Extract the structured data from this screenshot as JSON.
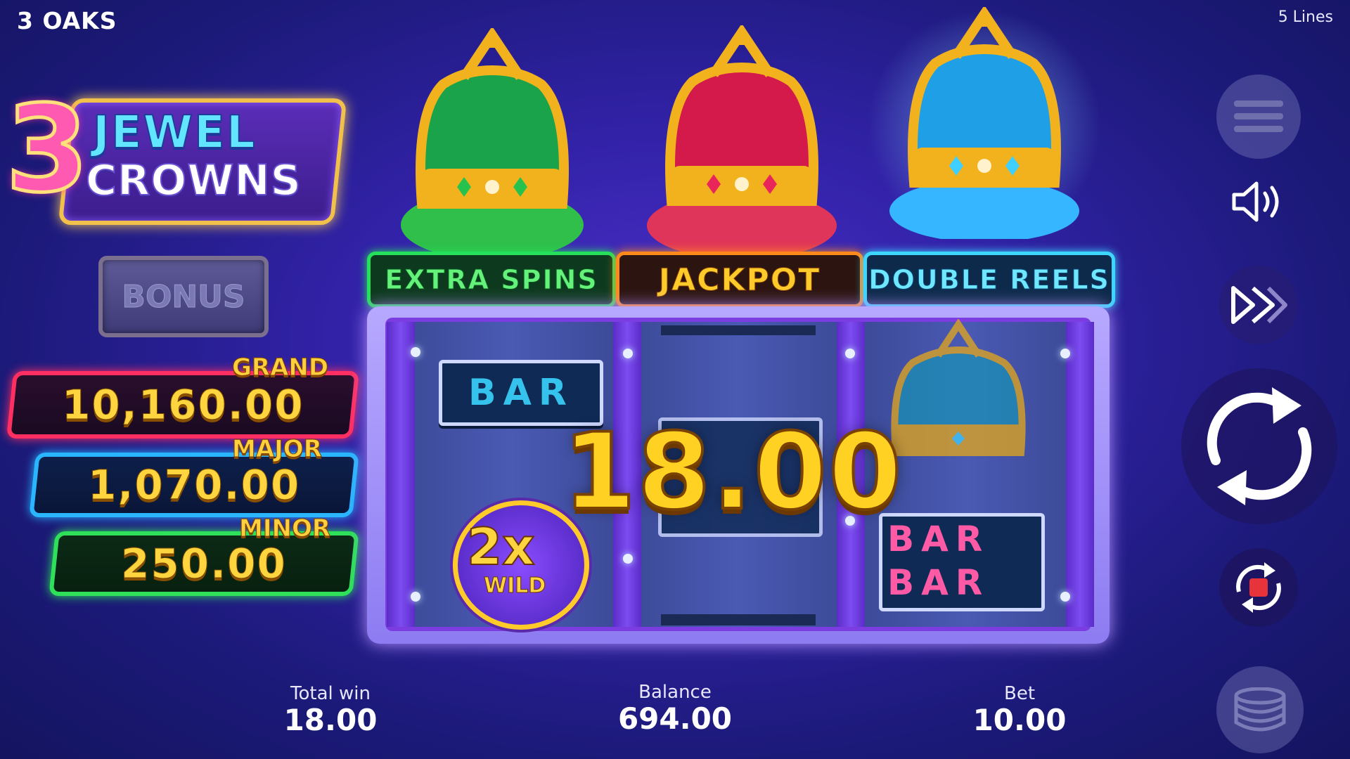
{
  "header": {
    "brand": "3 OAKS",
    "lines": "5 Lines"
  },
  "logo": {
    "digit": "3",
    "line1": "JEWEL",
    "line2": "CROWNS"
  },
  "bonus_button": "BONUS",
  "jackpots": {
    "grand": {
      "label": "GRAND",
      "value": "10,160.00"
    },
    "major": {
      "label": "MAJOR",
      "value": "1,070.00"
    },
    "minor": {
      "label": "MINOR",
      "value": "250.00"
    }
  },
  "features": {
    "extra_spins": "EXTRA SPINS",
    "jackpot": "JACKPOT",
    "double_reels": "DOUBLE REELS"
  },
  "reels": {
    "bar": "BAR",
    "wild_multiplier": "2x",
    "wild_label": "WILD"
  },
  "win_amount": "18.00",
  "footer": {
    "total_win_label": "Total win",
    "total_win_value": "18.00",
    "balance_label": "Balance",
    "balance_value": "694.00",
    "bet_label": "Bet",
    "bet_value": "10.00"
  },
  "colors": {
    "accent_gold": "#ffd122",
    "grand": "#ff2f62",
    "major": "#29b6ff",
    "minor": "#2ee05a"
  },
  "icons": [
    "menu-icon",
    "sound-icon",
    "fast-forward-icon",
    "spin-icon",
    "autoplay-stop-icon",
    "coins-icon"
  ]
}
